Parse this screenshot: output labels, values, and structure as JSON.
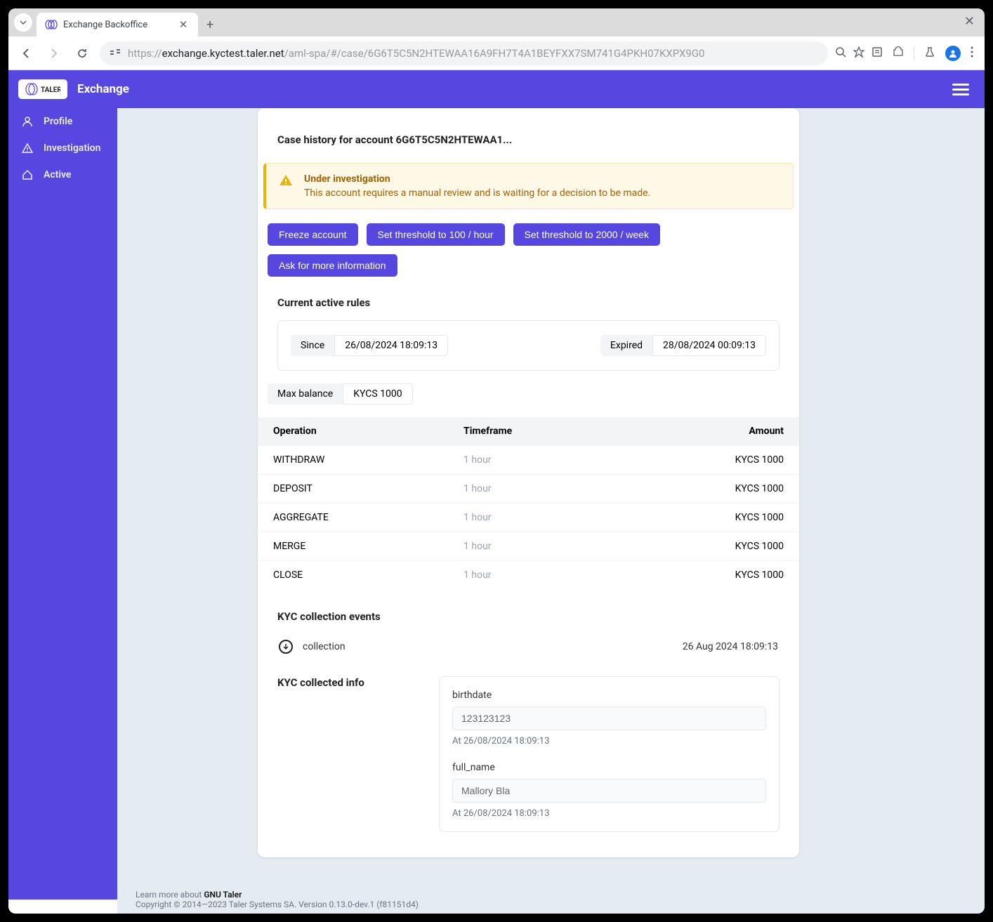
{
  "browser": {
    "tab_title": "Exchange Backoffice",
    "url_host": "exchange.kyctest.taler.net",
    "url_path": "/aml-spa/#/case/6G6T5C5N2HTEWAA16A9FH7T4A1BEYFXX7SM741G4PKH07KXPX9G0"
  },
  "app": {
    "title": "Exchange",
    "logo_text": "TALER"
  },
  "sidebar": {
    "items": [
      {
        "label": "Profile"
      },
      {
        "label": "Investigation"
      },
      {
        "label": "Active"
      }
    ]
  },
  "page": {
    "title": "Case history for account 6G6T5C5N2HTEWAA1...",
    "alert": {
      "title": "Under investigation",
      "text": "This account requires a manual review and is waiting for a decision to be made."
    },
    "actions": {
      "freeze": "Freeze account",
      "threshold100": "Set threshold to 100 / hour",
      "threshold2000": "Set threshold to 2000 / week",
      "ask": "Ask for more information"
    },
    "rules_title": "Current active rules",
    "rules_since_label": "Since",
    "rules_since_value": "26/08/2024 18:09:13",
    "rules_expired_label": "Expired",
    "rules_expired_value": "28/08/2024 00:09:13",
    "max_balance_label": "Max balance",
    "max_balance_value": "KYCS 1000",
    "table_headers": {
      "operation": "Operation",
      "timeframe": "Timeframe",
      "amount": "Amount"
    },
    "table_rows": [
      {
        "operation": "WITHDRAW",
        "timeframe": "1 hour",
        "amount": "KYCS 1000"
      },
      {
        "operation": "DEPOSIT",
        "timeframe": "1 hour",
        "amount": "KYCS 1000"
      },
      {
        "operation": "AGGREGATE",
        "timeframe": "1 hour",
        "amount": "KYCS 1000"
      },
      {
        "operation": "MERGE",
        "timeframe": "1 hour",
        "amount": "KYCS 1000"
      },
      {
        "operation": "CLOSE",
        "timeframe": "1 hour",
        "amount": "KYCS 1000"
      }
    ],
    "events_title": "KYC collection events",
    "event_label": "collection",
    "event_date": "26 Aug 2024 18:09:13",
    "collected_title": "KYC collected info",
    "collected": [
      {
        "label": "birthdate",
        "value": "123123123",
        "meta": "At 26/08/2024 18:09:13"
      },
      {
        "label": "full_name",
        "value": "Mallory Bla",
        "meta": "At 26/08/2024 18:09:13"
      }
    ]
  },
  "footer": {
    "learn": "Learn more about ",
    "link": "GNU Taler",
    "copyright": "Copyright © 2014—2023 Taler Systems SA. Version 0.13.0-dev.1 (f81151d4)"
  }
}
